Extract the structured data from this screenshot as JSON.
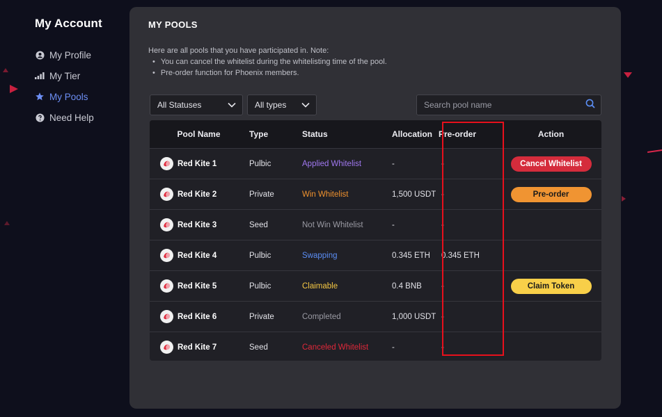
{
  "sidebar": {
    "title": "My Account",
    "items": [
      {
        "label": "My Profile",
        "icon": "user-icon",
        "active": false
      },
      {
        "label": "My Tier",
        "icon": "signal-bars-icon",
        "active": false
      },
      {
        "label": "My Pools",
        "icon": "star-icon",
        "active": true
      },
      {
        "label": "Need Help",
        "icon": "question-icon",
        "active": false
      }
    ]
  },
  "panel": {
    "title": "MY POOLS",
    "note": {
      "intro": "Here are all pools that you have participated in. Note:",
      "bullets": [
        "You can cancel the whitelist during the whitelisting time of the pool.",
        "Pre-order function for Phoenix members."
      ]
    },
    "filters": {
      "status": "All Statuses",
      "type": "All types",
      "search_placeholder": "Search pool name"
    },
    "table": {
      "headers": [
        "Pool Name",
        "Type",
        "Status",
        "Allocation",
        "Pre-order",
        "Action"
      ],
      "rows": [
        {
          "name": "Red Kite 1",
          "type": "Pulbic",
          "status": "Applied Whitelist",
          "allocation": "-",
          "preorder": "-",
          "action": "Cancel Whitelist"
        },
        {
          "name": "Red Kite 2",
          "type": "Private",
          "status": "Win Whitelist",
          "allocation": "1,500 USDT",
          "preorder": "-",
          "action": "Pre-order"
        },
        {
          "name": "Red Kite 3",
          "type": "Seed",
          "status": "Not Win Whitelist",
          "allocation": "-",
          "preorder": "-",
          "action": ""
        },
        {
          "name": "Red Kite 4",
          "type": "Pulbic",
          "status": "Swapping",
          "allocation": "0.345 ETH",
          "preorder": "0.345 ETH",
          "action": ""
        },
        {
          "name": "Red Kite 5",
          "type": "Pulbic",
          "status": "Claimable",
          "allocation": "0.4 BNB",
          "preorder": "-",
          "action": "Claim Token"
        },
        {
          "name": "Red Kite 6",
          "type": "Private",
          "status": "Completed",
          "allocation": "1,000 USDT",
          "preorder": "-",
          "action": ""
        },
        {
          "name": "Red Kite 7",
          "type": "Seed",
          "status": "Canceled Whitelist",
          "allocation": "-",
          "preorder": "-",
          "action": ""
        }
      ]
    }
  },
  "colors": {
    "active_nav": "#6d8ff5",
    "status_applied": "#a078f0",
    "status_win": "#f0922e",
    "status_notwin": "#9a9aa3",
    "status_swapping": "#5b8ef5",
    "status_claimable": "#f6c844",
    "status_completed": "#9a9aa3",
    "status_canceled": "#e0283a",
    "highlight_box": "#e8101c"
  }
}
